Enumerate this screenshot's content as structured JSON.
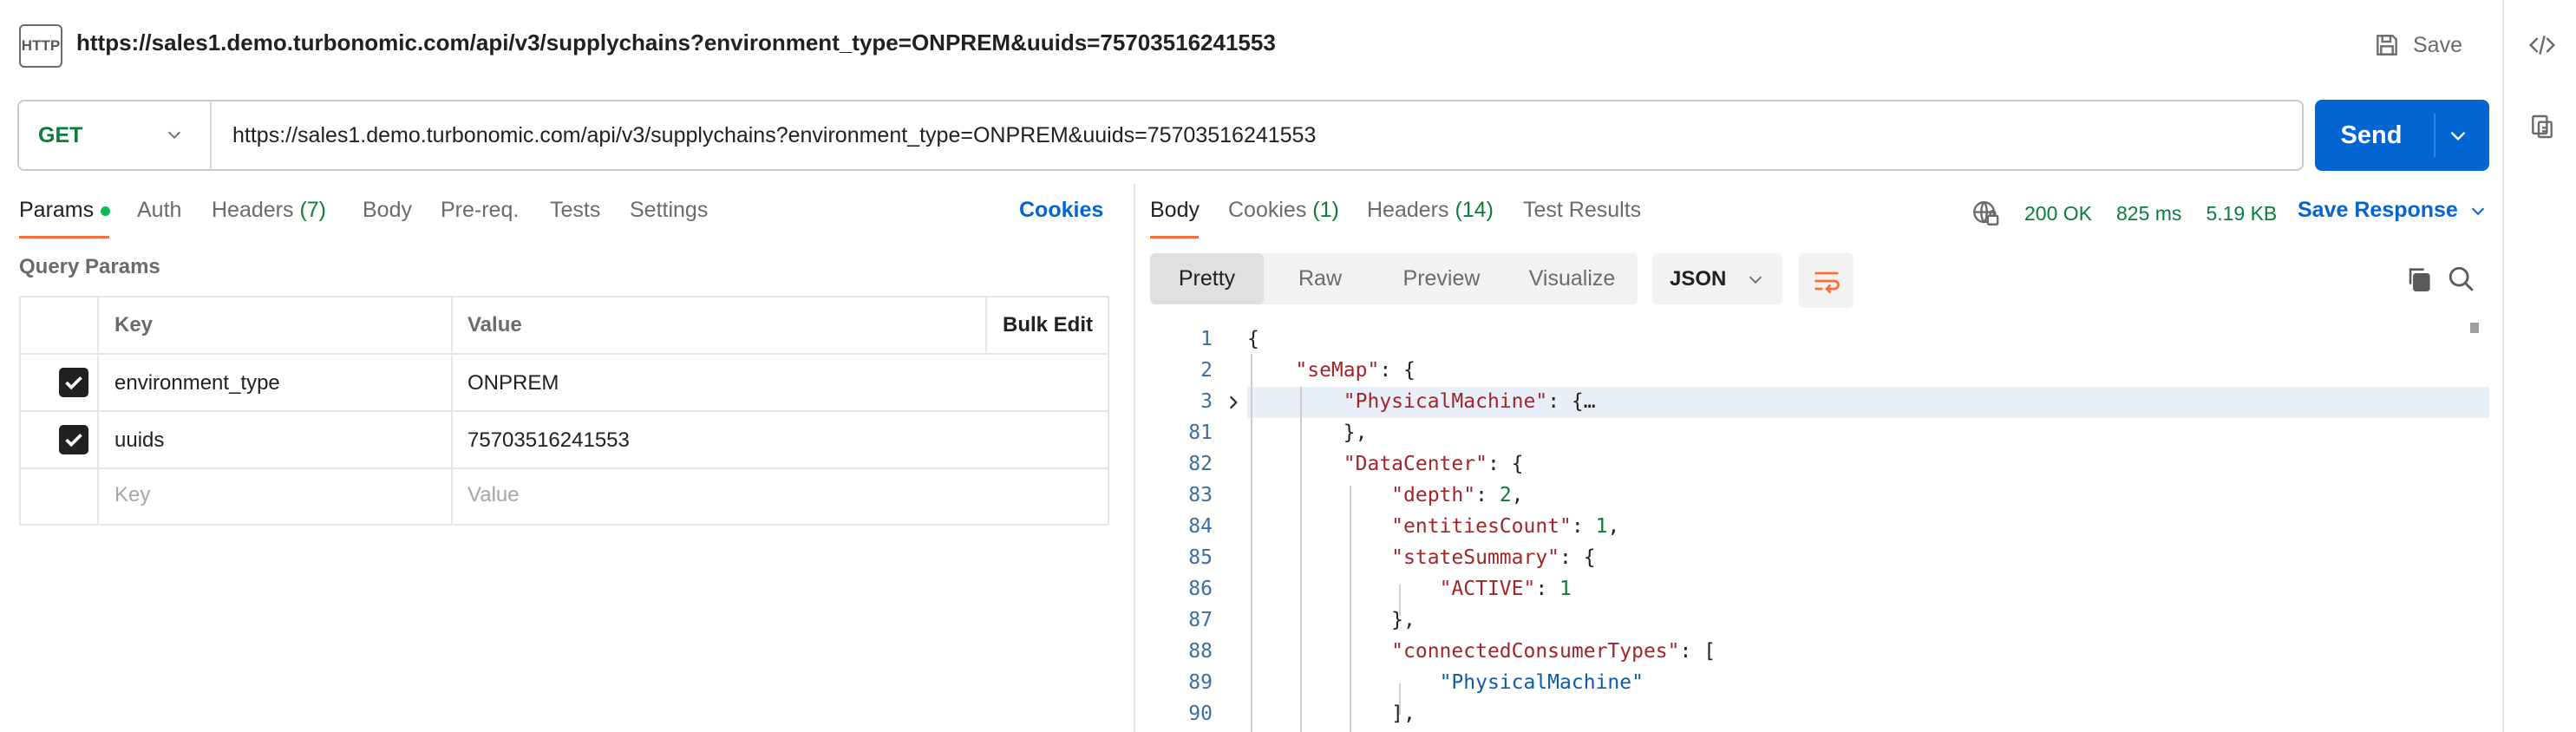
{
  "titlebar": {
    "icon_label": "HTTP",
    "title": "https://sales1.demo.turbonomic.com/api/v3/supplychains?environment_type=ONPREM&uuids=75703516241553",
    "save_label": "Save"
  },
  "request": {
    "method": "GET",
    "url": "https://sales1.demo.turbonomic.com/api/v3/supplychains?environment_type=ONPREM&uuids=75703516241553",
    "send_label": "Send"
  },
  "request_tabs": {
    "params": "Params",
    "auth": "Auth",
    "headers": "Headers",
    "headers_count": "(7)",
    "body": "Body",
    "prereq": "Pre-req.",
    "tests": "Tests",
    "settings": "Settings",
    "cookies": "Cookies"
  },
  "query_params": {
    "title": "Query Params",
    "col_key": "Key",
    "col_value": "Value",
    "bulk_edit": "Bulk Edit",
    "rows": [
      {
        "key": "environment_type",
        "value": "ONPREM",
        "checked": true
      },
      {
        "key": "uuids",
        "value": "75703516241553",
        "checked": true
      }
    ],
    "key_placeholder": "Key",
    "value_placeholder": "Value"
  },
  "response_tabs": {
    "body": "Body",
    "cookies": "Cookies",
    "cookies_count": "(1)",
    "headers": "Headers",
    "headers_count": "(14)",
    "test_results": "Test Results"
  },
  "response_status": {
    "status": "200 OK",
    "time": "825 ms",
    "size": "5.19 KB",
    "save_response": "Save Response"
  },
  "view_modes": {
    "pretty": "Pretty",
    "raw": "Raw",
    "preview": "Preview",
    "visualize": "Visualize",
    "format": "JSON"
  },
  "code_lines": [
    {
      "n": "1"
    },
    {
      "n": "2"
    },
    {
      "n": "3"
    },
    {
      "n": "81"
    },
    {
      "n": "82"
    },
    {
      "n": "83"
    },
    {
      "n": "84"
    },
    {
      "n": "85"
    },
    {
      "n": "86"
    },
    {
      "n": "87"
    },
    {
      "n": "88"
    },
    {
      "n": "89"
    },
    {
      "n": "90"
    }
  ],
  "code_tokens": {
    "se_map": "\"seMap\"",
    "physical_machine_key": "\"PhysicalMachine\"",
    "fold_ellipsis": "{…",
    "data_center": "\"DataCenter\"",
    "depth": "\"depth\"",
    "depth_val": "2",
    "entities_count": "\"entitiesCount\"",
    "entities_count_val": "1",
    "state_summary": "\"stateSummary\"",
    "active": "\"ACTIVE\"",
    "active_val": "1",
    "connected_consumer_types": "\"connectedConsumerTypes\"",
    "physical_machine_val": "\"PhysicalMachine\""
  },
  "colors": {
    "accent": "#ff6c37",
    "send": "#0265d2",
    "ok": "#0a7d3a",
    "json_key": "#a0262c",
    "json_string": "#0b5cad"
  }
}
